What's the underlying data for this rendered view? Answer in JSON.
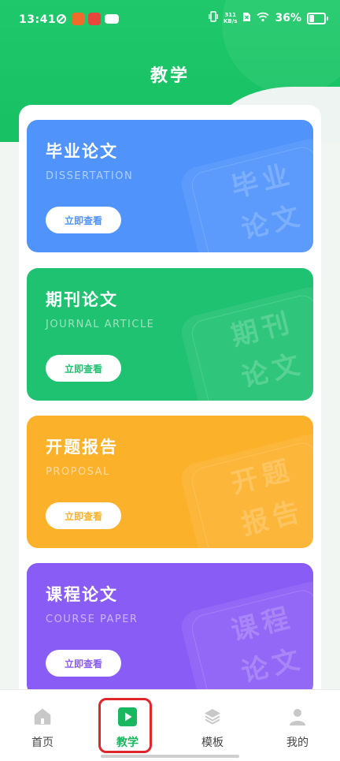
{
  "status_bar": {
    "time": "13:41",
    "net_speed_value": "311",
    "net_speed_unit": "KB/s",
    "battery": "36%",
    "battery_level": 0.36
  },
  "header": {
    "title": "教学"
  },
  "cards": [
    {
      "title": "毕业论文",
      "subtitle": "DISSERTATION",
      "button": "立即查看",
      "watermark_1": "毕业",
      "watermark_2": "论文",
      "color": "#4f93fb"
    },
    {
      "title": "期刊论文",
      "subtitle": "JOURNAL ARTICLE",
      "button": "立即查看",
      "watermark_1": "期刊",
      "watermark_2": "论文",
      "color": "#1ec270"
    },
    {
      "title": "开题报告",
      "subtitle": "PROPOSAL",
      "button": "立即查看",
      "watermark_1": "开题",
      "watermark_2": "报告",
      "color": "#fcb12a"
    },
    {
      "title": "课程论文",
      "subtitle": "COURSE PAPER",
      "button": "立即查看",
      "watermark_1": "课程",
      "watermark_2": "论文",
      "color": "#8a5cf6"
    }
  ],
  "bottom_nav": {
    "items": [
      {
        "label": "首页",
        "icon": "home-icon",
        "active": false
      },
      {
        "label": "教学",
        "icon": "play-icon",
        "active": true
      },
      {
        "label": "模板",
        "icon": "layers-icon",
        "active": false
      },
      {
        "label": "我的",
        "icon": "user-icon",
        "active": false
      }
    ]
  },
  "colors": {
    "brand_green": "#1fc96b",
    "active_nav": "#19b85e",
    "highlight": "#e0262b"
  }
}
